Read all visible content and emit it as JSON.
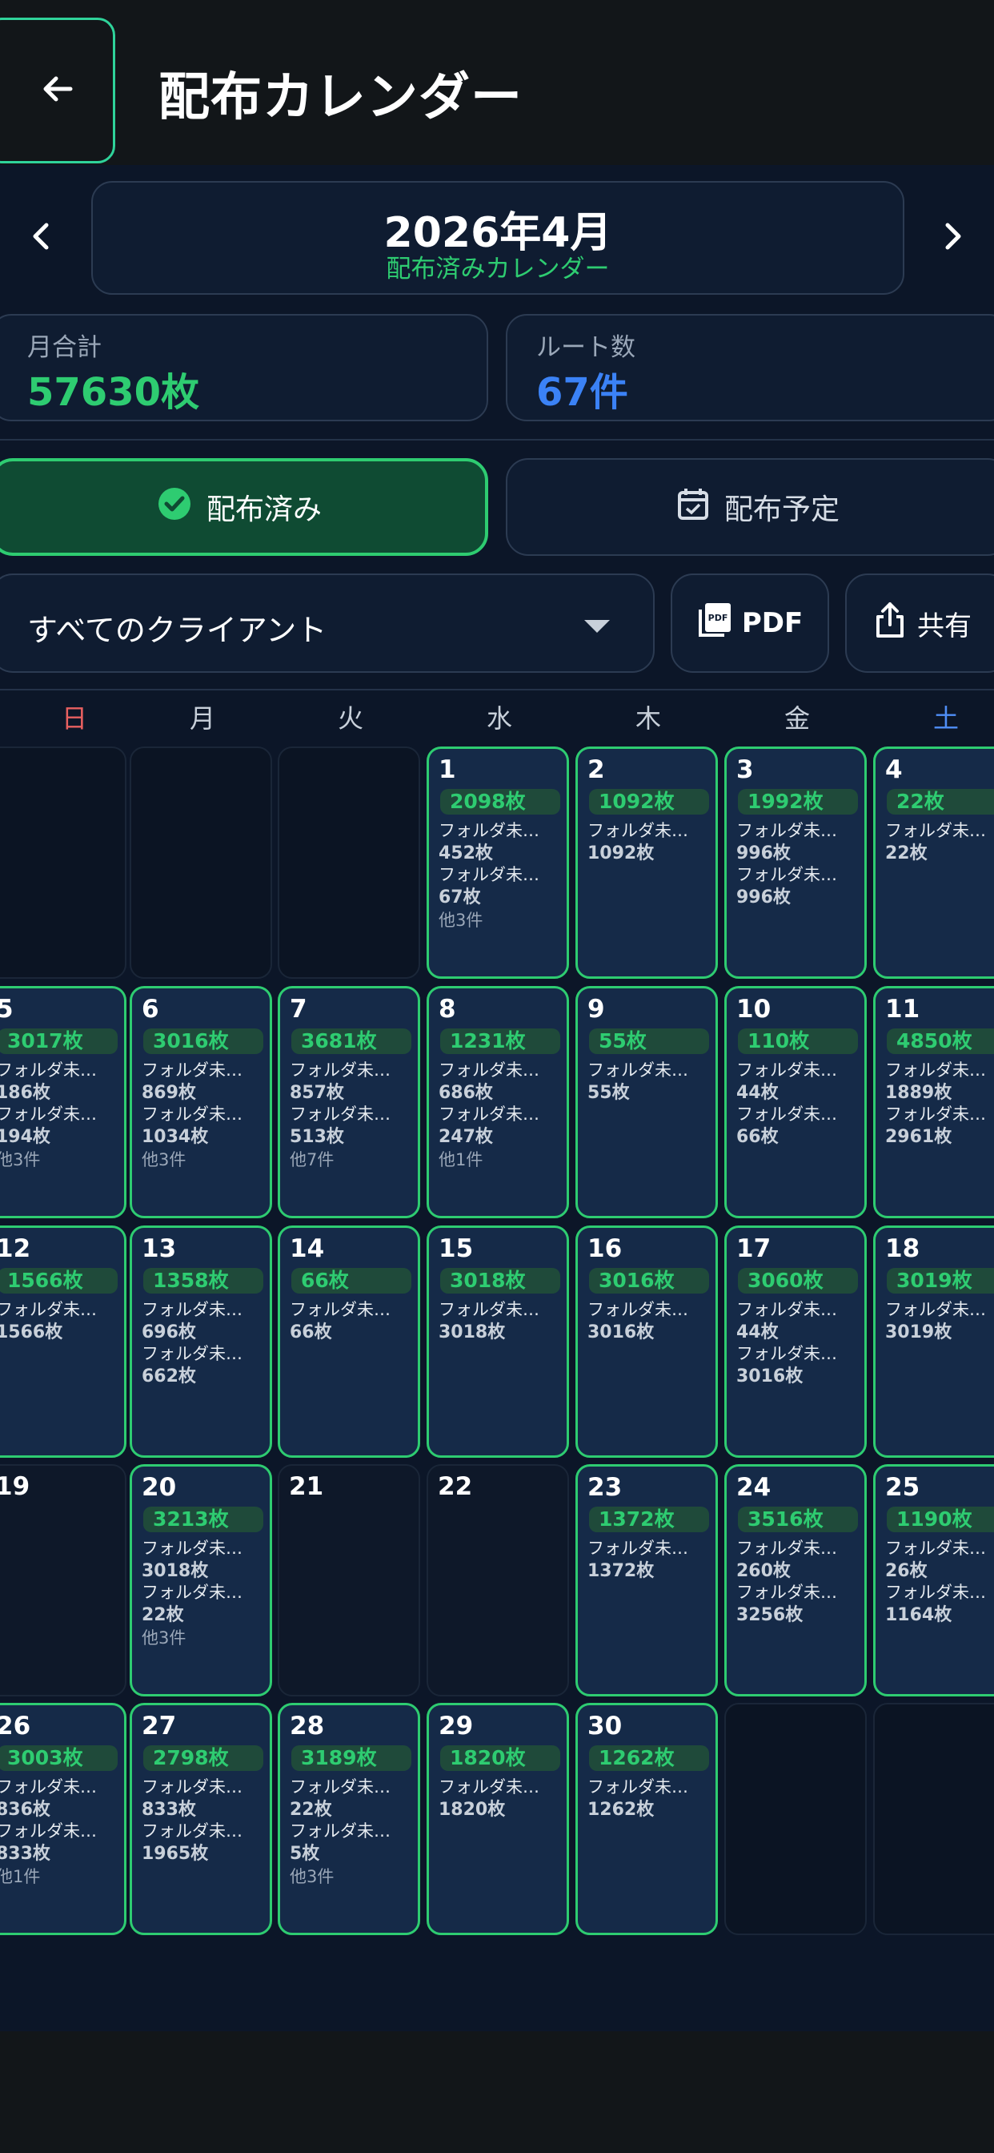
{
  "header": {
    "title": "配布カレンダー"
  },
  "month": {
    "title": "2026年4月",
    "subtitle": "配布済みカレンダー"
  },
  "stats": {
    "total_label": "月合計",
    "total_value": "57630枚",
    "routes_label": "ルート数",
    "routes_value": "67件"
  },
  "toggle": {
    "done_label": "配布済み",
    "planned_label": "配布予定"
  },
  "filter": {
    "client_value": "すべてのクライアント",
    "pdf_label": "PDF",
    "share_label": "共有"
  },
  "weekdays": [
    "日",
    "月",
    "火",
    "水",
    "木",
    "金",
    "土"
  ],
  "colors": {
    "accent_green": "#2ecc71",
    "accent_blue": "#3b82f6",
    "sunday_red": "#e86060",
    "saturday_blue": "#4f8ef7",
    "background": "#0c1628"
  },
  "days": [
    null,
    null,
    null,
    {
      "day": "1",
      "total": "2098枚",
      "entries": [
        [
          "フォルダ未…",
          "452枚"
        ],
        [
          "フォルダ未…",
          "67枚"
        ]
      ],
      "more": "他3件"
    },
    {
      "day": "2",
      "total": "1092枚",
      "entries": [
        [
          "フォルダ未…",
          "1092枚"
        ]
      ],
      "more": ""
    },
    {
      "day": "3",
      "total": "1992枚",
      "entries": [
        [
          "フォルダ未…",
          "996枚"
        ],
        [
          "フォルダ未…",
          "996枚"
        ]
      ],
      "more": ""
    },
    {
      "day": "4",
      "total": "22枚",
      "entries": [
        [
          "フォルダ未…",
          "22枚"
        ]
      ],
      "more": ""
    },
    {
      "day": "5",
      "total": "3017枚",
      "entries": [
        [
          "フォルダ未…",
          "186枚"
        ],
        [
          "フォルダ未…",
          "194枚"
        ]
      ],
      "more": "他3件"
    },
    {
      "day": "6",
      "total": "3016枚",
      "entries": [
        [
          "フォルダ未…",
          "869枚"
        ],
        [
          "フォルダ未…",
          "1034枚"
        ]
      ],
      "more": "他3件"
    },
    {
      "day": "7",
      "total": "3681枚",
      "entries": [
        [
          "フォルダ未…",
          "857枚"
        ],
        [
          "フォルダ未…",
          "513枚"
        ]
      ],
      "more": "他7件"
    },
    {
      "day": "8",
      "total": "1231枚",
      "entries": [
        [
          "フォルダ未…",
          "686枚"
        ],
        [
          "フォルダ未…",
          "247枚"
        ]
      ],
      "more": "他1件"
    },
    {
      "day": "9",
      "total": "55枚",
      "entries": [
        [
          "フォルダ未…",
          "55枚"
        ]
      ],
      "more": ""
    },
    {
      "day": "10",
      "total": "110枚",
      "entries": [
        [
          "フォルダ未…",
          "44枚"
        ],
        [
          "フォルダ未…",
          "66枚"
        ]
      ],
      "more": ""
    },
    {
      "day": "11",
      "total": "4850枚",
      "entries": [
        [
          "フォルダ未…",
          "1889枚"
        ],
        [
          "フォルダ未…",
          "2961枚"
        ]
      ],
      "more": ""
    },
    {
      "day": "12",
      "total": "1566枚",
      "entries": [
        [
          "フォルダ未…",
          "1566枚"
        ]
      ],
      "more": ""
    },
    {
      "day": "13",
      "total": "1358枚",
      "entries": [
        [
          "フォルダ未…",
          "696枚"
        ],
        [
          "フォルダ未…",
          "662枚"
        ]
      ],
      "more": ""
    },
    {
      "day": "14",
      "total": "66枚",
      "entries": [
        [
          "フォルダ未…",
          "66枚"
        ]
      ],
      "more": ""
    },
    {
      "day": "15",
      "total": "3018枚",
      "entries": [
        [
          "フォルダ未…",
          "3018枚"
        ]
      ],
      "more": ""
    },
    {
      "day": "16",
      "total": "3016枚",
      "entries": [
        [
          "フォルダ未…",
          "3016枚"
        ]
      ],
      "more": ""
    },
    {
      "day": "17",
      "total": "3060枚",
      "entries": [
        [
          "フォルダ未…",
          "44枚"
        ],
        [
          "フォルダ未…",
          "3016枚"
        ]
      ],
      "more": ""
    },
    {
      "day": "18",
      "total": "3019枚",
      "entries": [
        [
          "フォルダ未…",
          "3019枚"
        ]
      ],
      "more": ""
    },
    {
      "day": "19",
      "total": "",
      "entries": [],
      "more": ""
    },
    {
      "day": "20",
      "total": "3213枚",
      "entries": [
        [
          "フォルダ未…",
          "3018枚"
        ],
        [
          "フォルダ未…",
          "22枚"
        ]
      ],
      "more": "他3件"
    },
    {
      "day": "21",
      "total": "",
      "entries": [],
      "more": ""
    },
    {
      "day": "22",
      "total": "",
      "entries": [],
      "more": ""
    },
    {
      "day": "23",
      "total": "1372枚",
      "entries": [
        [
          "フォルダ未…",
          "1372枚"
        ]
      ],
      "more": ""
    },
    {
      "day": "24",
      "total": "3516枚",
      "entries": [
        [
          "フォルダ未…",
          "260枚"
        ],
        [
          "フォルダ未…",
          "3256枚"
        ]
      ],
      "more": ""
    },
    {
      "day": "25",
      "total": "1190枚",
      "entries": [
        [
          "フォルダ未…",
          "26枚"
        ],
        [
          "フォルダ未…",
          "1164枚"
        ]
      ],
      "more": ""
    },
    {
      "day": "26",
      "total": "3003枚",
      "entries": [
        [
          "フォルダ未…",
          "836枚"
        ],
        [
          "フォルダ未…",
          "833枚"
        ]
      ],
      "more": "他1件"
    },
    {
      "day": "27",
      "total": "2798枚",
      "entries": [
        [
          "フォルダ未…",
          "833枚"
        ],
        [
          "フォルダ未…",
          "1965枚"
        ]
      ],
      "more": ""
    },
    {
      "day": "28",
      "total": "3189枚",
      "entries": [
        [
          "フォルダ未…",
          "22枚"
        ],
        [
          "フォルダ未…",
          "5枚"
        ]
      ],
      "more": "他3件"
    },
    {
      "day": "29",
      "total": "1820枚",
      "entries": [
        [
          "フォルダ未…",
          "1820枚"
        ]
      ],
      "more": ""
    },
    {
      "day": "30",
      "total": "1262枚",
      "entries": [
        [
          "フォルダ未…",
          "1262枚"
        ]
      ],
      "more": ""
    },
    null,
    null
  ]
}
